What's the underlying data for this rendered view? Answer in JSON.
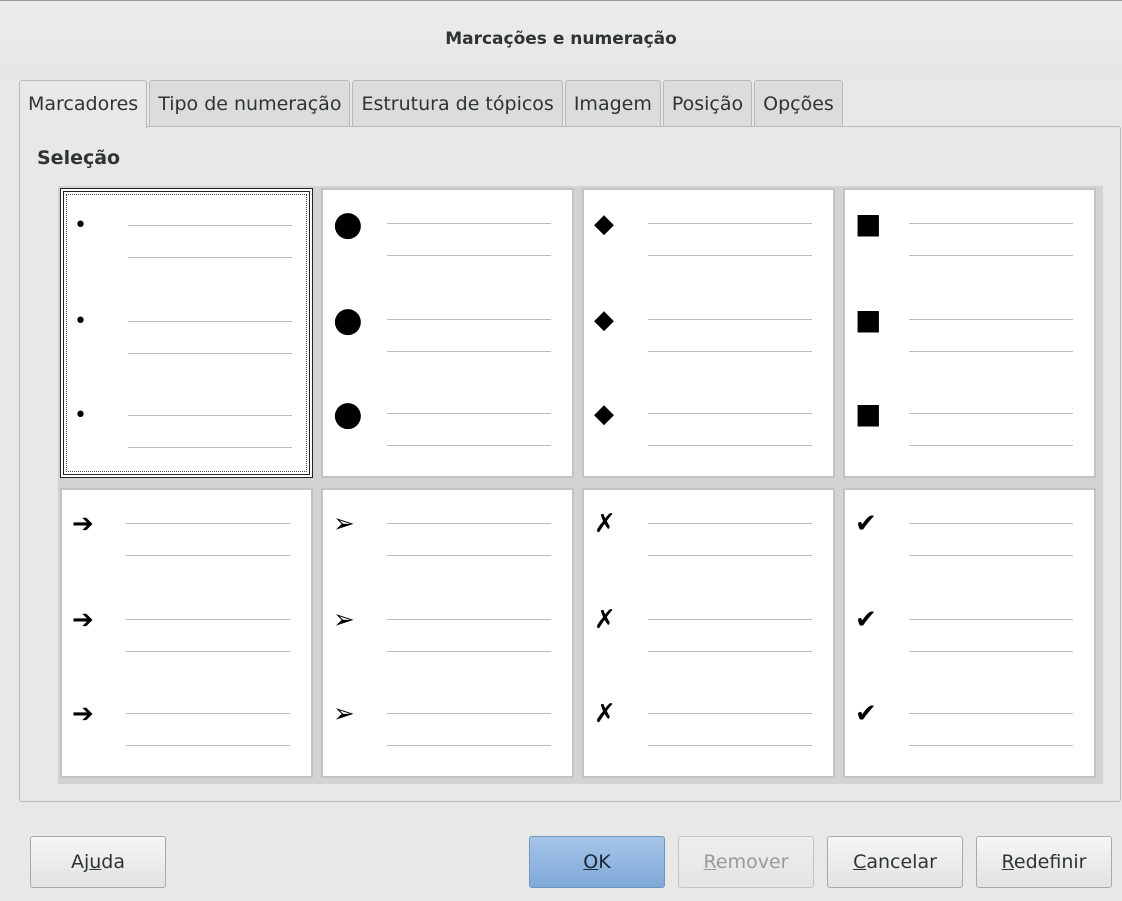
{
  "window": {
    "title": "Marcações e numeração"
  },
  "tabs": [
    {
      "label": "Marcadores",
      "active": true
    },
    {
      "label": "Tipo de numeração",
      "active": false
    },
    {
      "label": "Estrutura de tópicos",
      "active": false
    },
    {
      "label": "Imagem",
      "active": false
    },
    {
      "label": "Posição",
      "active": false
    },
    {
      "label": "Opções",
      "active": false
    }
  ],
  "panel": {
    "section_label": "Seleção"
  },
  "bullet_styles": [
    {
      "name": "small-dot",
      "glyph": "•",
      "selected": true
    },
    {
      "name": "large-circle",
      "glyph": "●",
      "selected": false
    },
    {
      "name": "diamond",
      "glyph": "◆",
      "selected": false
    },
    {
      "name": "square",
      "glyph": "■",
      "selected": false
    },
    {
      "name": "arrow",
      "glyph": "➔",
      "selected": false
    },
    {
      "name": "arrowhead",
      "glyph": "➢",
      "selected": false
    },
    {
      "name": "cross-mark",
      "glyph": "✗",
      "selected": false
    },
    {
      "name": "check-mark",
      "glyph": "✔",
      "selected": false
    }
  ],
  "buttons": {
    "help": {
      "pre": "Aj",
      "mnemonic": "u",
      "post": "da"
    },
    "ok": {
      "pre": "",
      "mnemonic": "O",
      "post": "K"
    },
    "remove": {
      "pre": "",
      "mnemonic": "R",
      "post": "emover",
      "disabled": true
    },
    "cancel": {
      "pre": "",
      "mnemonic": "C",
      "post": "ancelar"
    },
    "reset": {
      "pre": "",
      "mnemonic": "R",
      "post": "edefinir"
    }
  },
  "colors": {
    "accent": "#7fa9d9",
    "background": "#e8e8e7"
  }
}
